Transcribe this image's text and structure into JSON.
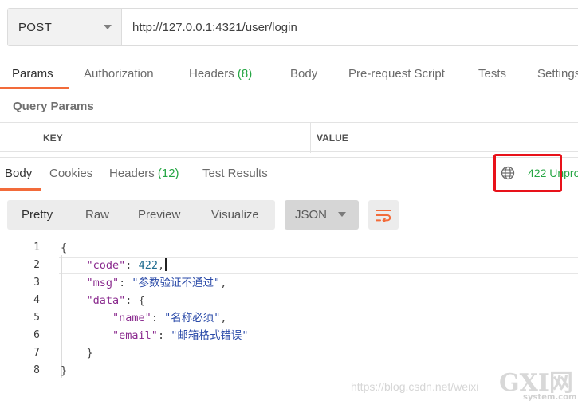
{
  "request": {
    "method": "POST",
    "url": "http://127.0.0.1:4321/user/login"
  },
  "request_tabs": [
    {
      "label": "Params"
    },
    {
      "label": "Authorization"
    },
    {
      "label": "Headers",
      "count": "(8)"
    },
    {
      "label": "Body"
    },
    {
      "label": "Pre-request Script"
    },
    {
      "label": "Tests"
    },
    {
      "label": "Settings"
    }
  ],
  "query_params": {
    "title": "Query Params",
    "columns": [
      "KEY",
      "VALUE"
    ]
  },
  "response_tabs": [
    {
      "label": "Body"
    },
    {
      "label": "Cookies"
    },
    {
      "label": "Headers",
      "count": "(12)"
    },
    {
      "label": "Test Results"
    }
  ],
  "status": {
    "text": "422 Unpro",
    "icon": "globe-icon",
    "color": "#26a644"
  },
  "view_modes": [
    "Pretty",
    "Raw",
    "Preview",
    "Visualize"
  ],
  "format": "JSON",
  "code_lines": [
    {
      "n": "1"
    },
    {
      "n": "2",
      "key": "\"code\"",
      "num": "422",
      "tail": ","
    },
    {
      "n": "3",
      "key": "\"msg\"",
      "str": "\"参数验证不通过\"",
      "tail": ","
    },
    {
      "n": "4",
      "key": "\"data\"",
      "tail": "{"
    },
    {
      "n": "5",
      "key": "\"name\"",
      "str": "\"名称必须\"",
      "tail": ","
    },
    {
      "n": "6",
      "key": "\"email\"",
      "str": "\"邮箱格式错误\""
    },
    {
      "n": "7",
      "tail": "}"
    },
    {
      "n": "8",
      "tail": "}"
    }
  ],
  "watermark": {
    "text": "https://blog.csdn.net/weixi",
    "logo_main": "GXI网",
    "logo_sub": "system.com"
  },
  "colors": {
    "accent": "#f26b3a",
    "highlight": "#e8121a",
    "status_green": "#26a644"
  }
}
